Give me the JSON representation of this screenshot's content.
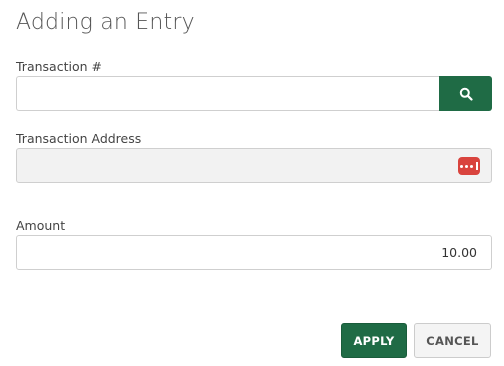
{
  "dialog": {
    "title": "Adding an Entry"
  },
  "transaction_number": {
    "label": "Transaction #",
    "value": "",
    "search_icon": "search-icon"
  },
  "transaction_address": {
    "label": "Transaction Address",
    "value": "",
    "more_icon": "more-options-icon"
  },
  "amount": {
    "label": "Amount",
    "value": "10.00"
  },
  "actions": {
    "apply_label": "APPLY",
    "cancel_label": "CANCEL"
  },
  "colors": {
    "primary": "#1f6b45",
    "danger": "#d9443e",
    "readonly_bg": "#f2f2f2",
    "border": "#cfcfcf"
  }
}
